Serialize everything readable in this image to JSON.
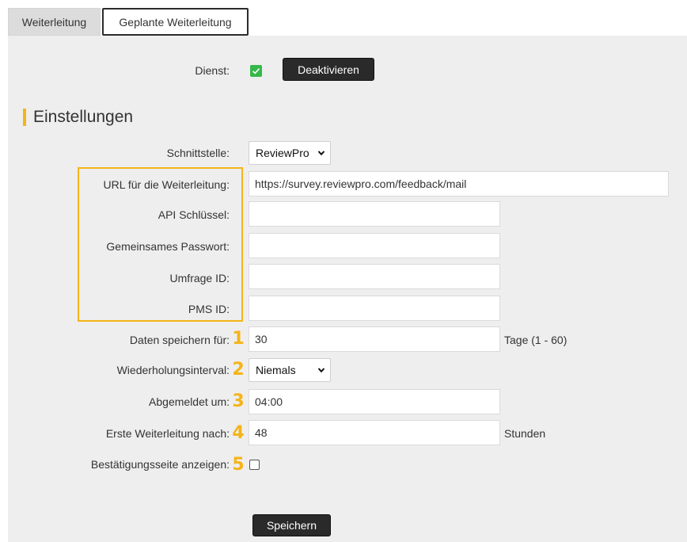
{
  "tabs": [
    {
      "label": "Weiterleitung",
      "active": false
    },
    {
      "label": "Geplante Weiterleitung",
      "active": true
    }
  ],
  "service": {
    "label": "Dienst:",
    "checked": true,
    "toggle_button": "Deaktivieren"
  },
  "section": {
    "title": "Einstellungen",
    "accent_color": "#f5b418"
  },
  "fields": {
    "interface": {
      "label": "Schnittstelle:",
      "value": "ReviewPro"
    },
    "url": {
      "label": "URL für die Weiterleitung:",
      "value": "https://survey.reviewpro.com/feedback/mail"
    },
    "api_key": {
      "label": "API Schlüssel:",
      "value": ""
    },
    "shared_password": {
      "label": "Gemeinsames Passwort:",
      "value": ""
    },
    "survey_id": {
      "label": "Umfrage ID:",
      "value": ""
    },
    "pms_id": {
      "label": "PMS ID:",
      "value": ""
    },
    "store_data": {
      "label": "Daten speichern für:",
      "value": "30",
      "suffix": "Tage (1 - 60)",
      "marker": "1"
    },
    "repeat_interval": {
      "label": "Wiederholungsinterval:",
      "value": "Niemals",
      "marker": "2"
    },
    "unsubscribed_at": {
      "label": "Abgemeldet um:",
      "value": "04:00",
      "marker": "3"
    },
    "first_forward_after": {
      "label": "Erste Weiterleitung nach:",
      "value": "48",
      "suffix": "Stunden",
      "marker": "4"
    },
    "show_confirmation": {
      "label": "Bestätigungsseite anzeigen:",
      "checked": false,
      "marker": "5"
    }
  },
  "save_button": "Speichern",
  "highlight_color": "#f5b418",
  "check_color": "#35b84a"
}
